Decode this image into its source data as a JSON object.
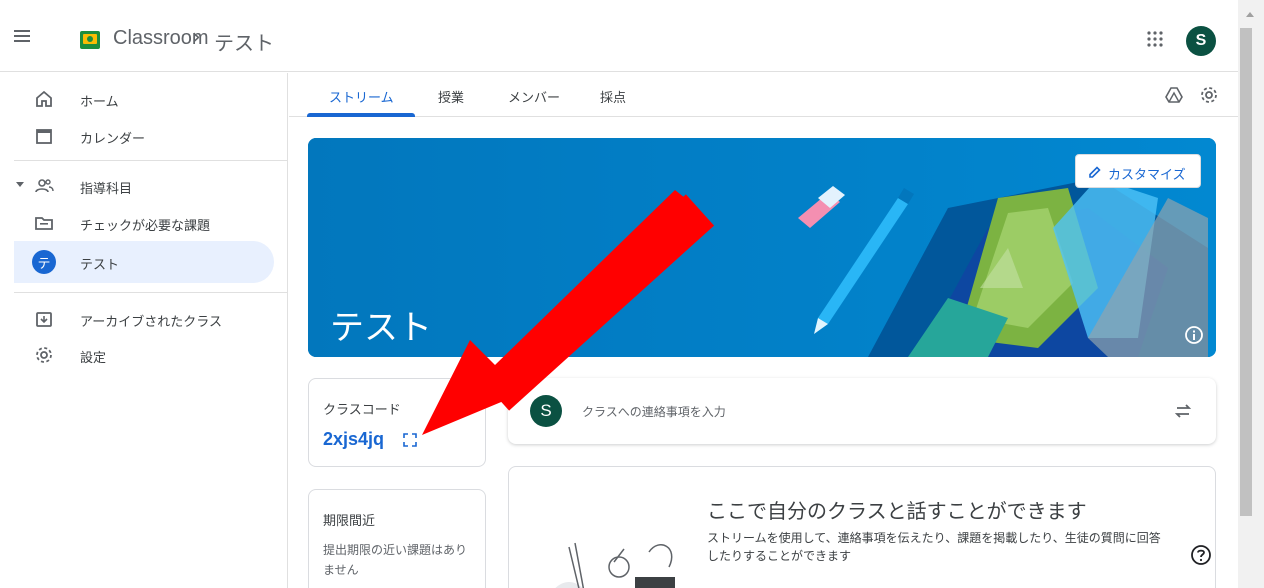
{
  "header": {
    "app_title": "Classroom",
    "breadcrumb_sep": "›",
    "breadcrumb_class": "テスト",
    "avatar_letter": "S"
  },
  "sidebar": {
    "items": [
      {
        "label": "ホーム",
        "icon": "home-icon"
      },
      {
        "label": "カレンダー",
        "icon": "calendar-icon"
      },
      {
        "label": "指導科目",
        "icon": "people-icon"
      },
      {
        "label": "チェックが必要な課題",
        "icon": "folder-icon"
      },
      {
        "label": "テスト",
        "icon": "class-avatar",
        "avatar": "テ"
      },
      {
        "label": "アーカイブされたクラス",
        "icon": "archive-icon"
      },
      {
        "label": "設定",
        "icon": "gear-icon"
      }
    ]
  },
  "tabs": [
    {
      "label": "ストリーム",
      "active": true
    },
    {
      "label": "授業",
      "active": false
    },
    {
      "label": "メンバー",
      "active": false
    },
    {
      "label": "採点",
      "active": false
    }
  ],
  "banner": {
    "class_name": "テスト",
    "customize_label": "カスタマイズ"
  },
  "class_code": {
    "label": "クラスコード",
    "value": "2xjs4jq"
  },
  "due": {
    "title": "期限間近",
    "text": "提出期限の近い課題はありません"
  },
  "announce": {
    "avatar_letter": "S",
    "placeholder": "クラスへの連絡事項を入力"
  },
  "talk": {
    "title": "ここで自分のクラスと話すことができます",
    "description": "ストリームを使用して、連絡事項を伝えたり、課題を掲載したり、生徒の質問に回答したりすることができます"
  },
  "colors": {
    "accent": "#1967d2",
    "banner": "#0277bd",
    "avatar": "#0b5142",
    "arrow": "#ff0000"
  }
}
